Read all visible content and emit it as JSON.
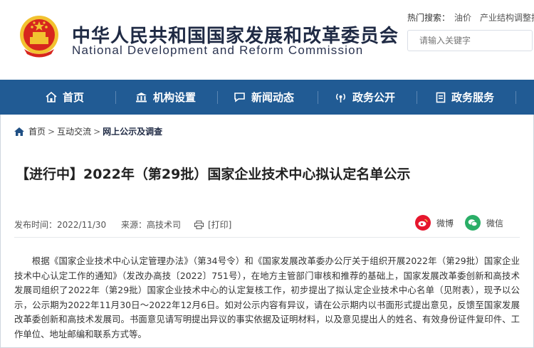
{
  "header": {
    "title_cn": "中华人民共和国国家发展和改革委员会",
    "title_en": "National Development and Reform Commission",
    "hot_search_label": "热门搜索：",
    "hot_search_items": [
      "油价",
      "产业结构调整指导"
    ],
    "search_placeholder": "请输入关键字"
  },
  "nav": {
    "items": [
      {
        "label": "首页",
        "icon": "home-icon"
      },
      {
        "label": "机构设置",
        "icon": "building-icon"
      },
      {
        "label": "新闻动态",
        "icon": "chat-icon"
      },
      {
        "label": "政务公开",
        "icon": "broadcast-icon"
      },
      {
        "label": "政务服务",
        "icon": "doc-icon"
      }
    ]
  },
  "breadcrumb": {
    "items": [
      "首页",
      "互动交流",
      "网上公示及调查"
    ],
    "separator": ">"
  },
  "article": {
    "title": "【进行中】2022年（第29批）国家企业技术中心拟认定名单公示",
    "publish_label": "发布时间：",
    "publish_date": "2022/11/30",
    "source_label": "来源：",
    "source": "高技术司",
    "print_label": "[打印]",
    "share": {
      "weibo": "微博",
      "wechat": "微信"
    },
    "body": "根据《国家企业技术中心认定管理办法》（第34号令）和《国家发展改革委办公厅关于组织开展2022年（第29批）国家企业技术中心认定工作的通知》（发改办高技〔2022〕751号），在地方主管部门审核和推荐的基础上，国家发展改革委创新和高技术发展司组织了2022年（第29批）国家企业技术中心的认定复核工作，初步提出了拟认定企业技术中心名单（见附表），现予以公示，公示期为2022年11月30日～2022年12月6日。如对公示内容有异议，请在公示期内以书面形式提出意见，反馈至国家发展改革委创新和高技术发展司。书面意见请写明提出异议的事实依据及证明材料，以及意见提出人的姓名、有效身份证件复印件、工作单位、地址邮编和联系方式等。"
  },
  "colors": {
    "nav_bg": "#215b94",
    "emblem_red": "#d7261d",
    "emblem_gold": "#f2c230",
    "weibo": "#e6162d",
    "wechat": "#2aae67"
  }
}
